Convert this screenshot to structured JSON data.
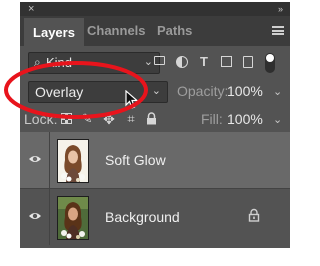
{
  "window": {
    "close_glyph": "×",
    "collapse_glyph": "»"
  },
  "tabs": [
    {
      "label": "Layers",
      "active": true
    },
    {
      "label": "Channels",
      "active": false
    },
    {
      "label": "Paths",
      "active": false
    }
  ],
  "filter": {
    "kind_label": "Kind",
    "icons": [
      "pixel-layer-filter-icon",
      "adjustment-layer-filter-icon",
      "type-layer-filter-icon",
      "shape-layer-filter-icon",
      "smart-object-filter-icon"
    ],
    "type_glyph": "T",
    "toggle_on": true
  },
  "blend": {
    "mode": "Overlay",
    "opacity_label": "Opacity:",
    "opacity_value": "100%"
  },
  "lock": {
    "label": "Lock:",
    "move_glyph": "✥",
    "brush_glyph": "✎",
    "artboard_glyph": "⌗",
    "all_glyph": "🔒",
    "fill_label": "Fill:",
    "fill_value": "100%"
  },
  "layers": [
    {
      "name": "Soft Glow",
      "selected": true,
      "visible": true,
      "locked": false
    },
    {
      "name": "Background",
      "selected": false,
      "visible": true,
      "locked": true
    }
  ],
  "colors": {
    "panel_bg": "#535353",
    "tabbar_bg": "#3c3c3c",
    "selected_layer": "#696969",
    "annotation_red": "#e8141c"
  }
}
